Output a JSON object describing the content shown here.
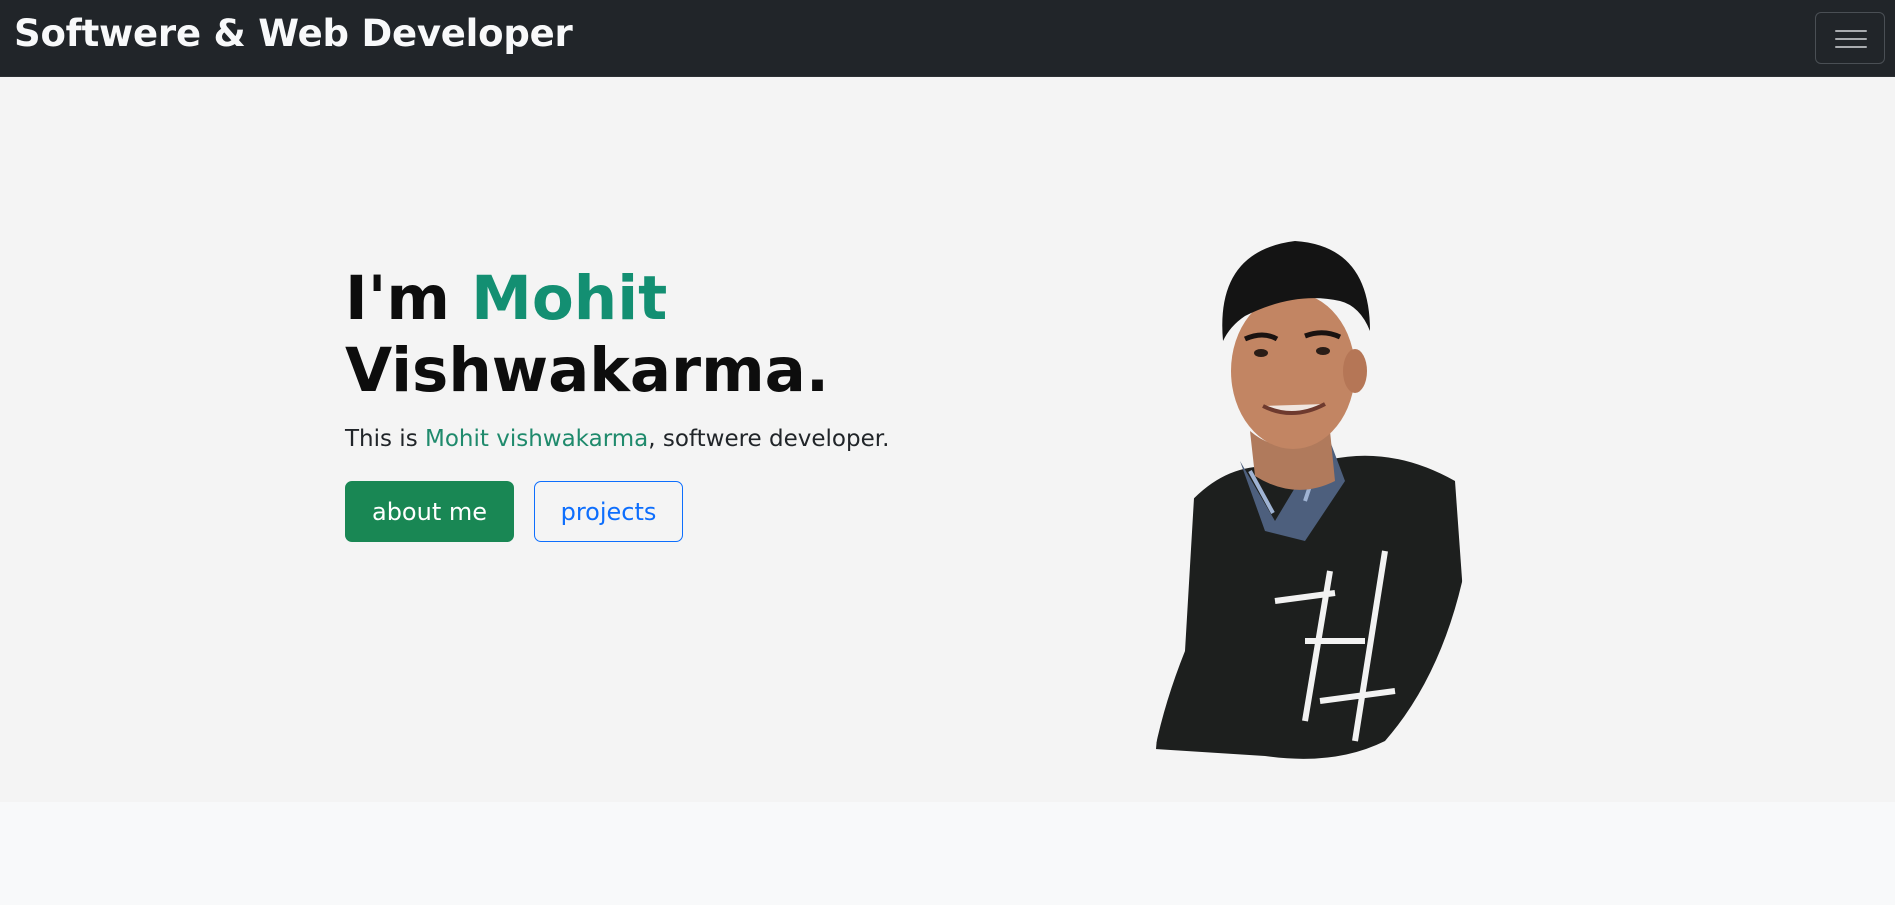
{
  "navbar": {
    "brand": "Softwere & Web Developer",
    "toggler_icon": "hamburger-menu-icon"
  },
  "hero": {
    "heading_prefix": "I'm ",
    "heading_name": "Mohit",
    "heading_line2": "Vishwakarma.",
    "subtitle_prefix": "This is ",
    "subtitle_name": "Mohit vishwakarma",
    "subtitle_suffix": ", softwere developer.",
    "about_button": "about me",
    "projects_button": "projects"
  },
  "colors": {
    "navbar_bg": "#212529",
    "accent_green": "#138f72",
    "success_button": "#198754",
    "primary_outline": "#0d6efd",
    "hero_bg": "#f4f4f4"
  }
}
